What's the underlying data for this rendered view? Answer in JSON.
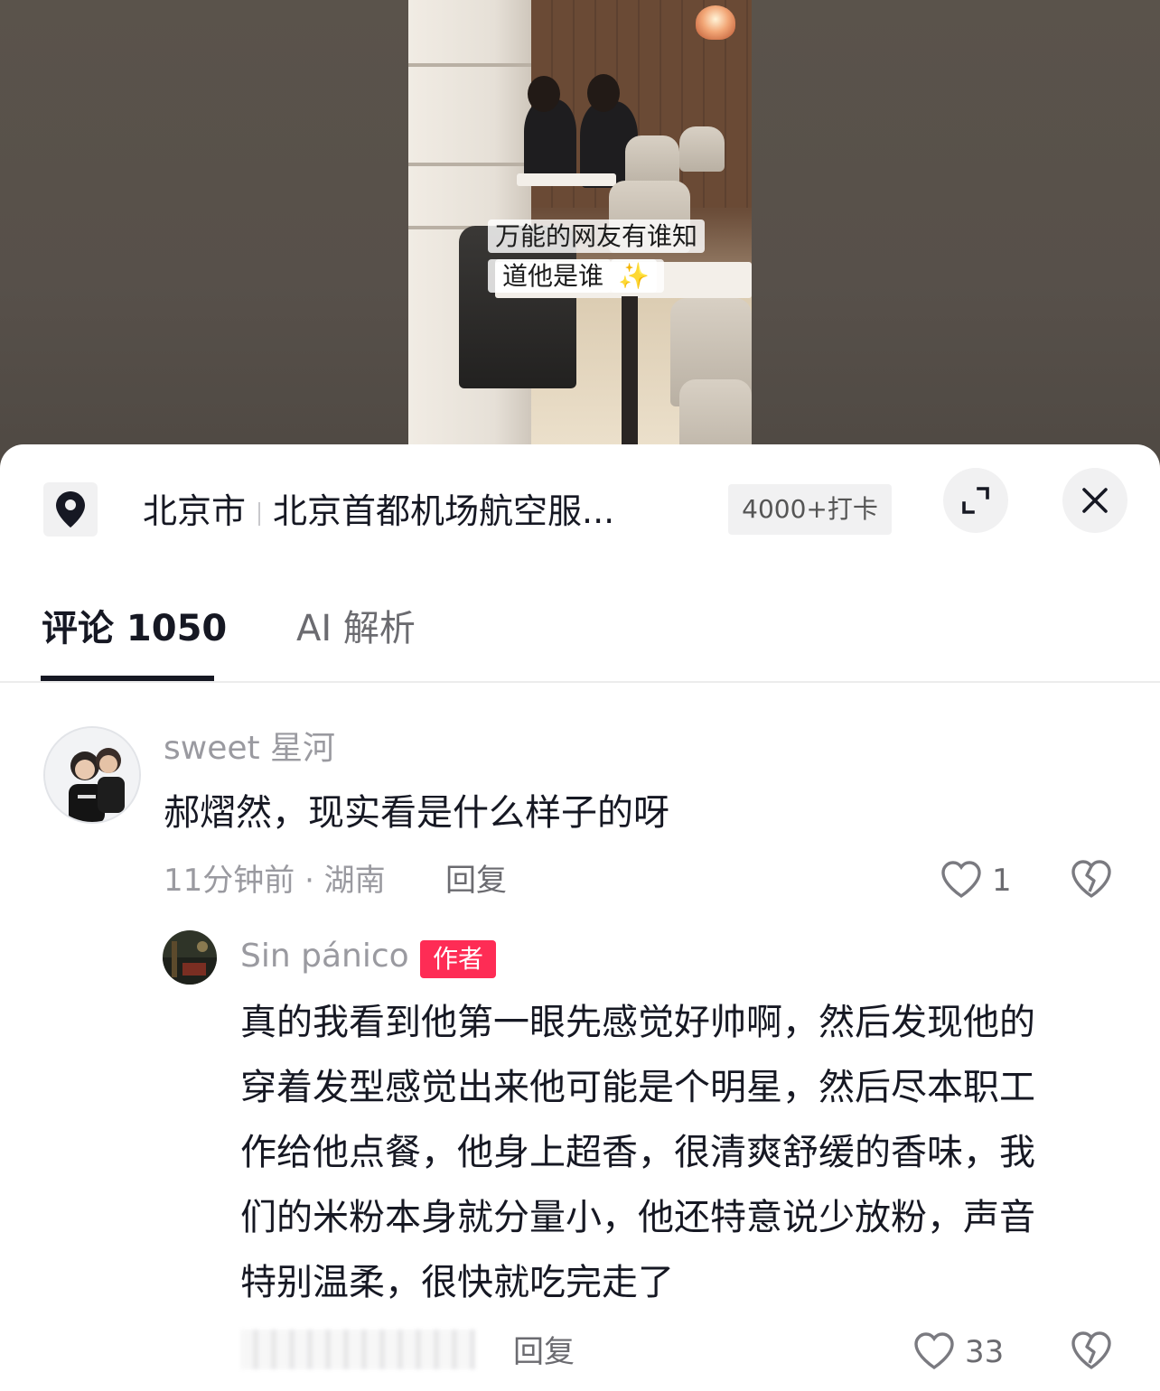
{
  "video": {
    "caption_line1": "万能的网友有谁知",
    "caption_line2": "道他是谁",
    "caption_emoji": "✨"
  },
  "location": {
    "icon": "location-pin-icon",
    "city": "北京市",
    "place": "北京首都机场航空服...",
    "checkins": "4000+打卡"
  },
  "header_buttons": {
    "expand_icon": "expand-icon",
    "close_icon": "close-icon"
  },
  "tabs": [
    {
      "label": "评论 1050",
      "active": true
    },
    {
      "label": "AI 解析",
      "active": false
    }
  ],
  "comments": [
    {
      "nickname": "sweet 星河",
      "text": "郝熠然，现实看是什么样子的呀",
      "time_location": "11分钟前 · 湖南",
      "reply_label": "回复",
      "likes": "1",
      "replies": [
        {
          "nickname": "Sin pánico",
          "badge": "作者",
          "text_lines": [
            "真的我看到他第一眼先感觉好帅啊，然后发现他的",
            "穿着发型感觉出来他可能是个明星，然后尽本职工",
            "作给他点餐，他身上超香，很清爽舒缓的香味，我",
            "们的米粉本身就分量小，他还特意说少放粉，声音",
            "特别温柔，很快就吃完走了"
          ],
          "reply_label": "回复",
          "likes": "33"
        }
      ]
    }
  ],
  "colors": {
    "accent_red": "#fe2c55",
    "text_primary": "#161823",
    "text_secondary": "#9a9aa0"
  }
}
